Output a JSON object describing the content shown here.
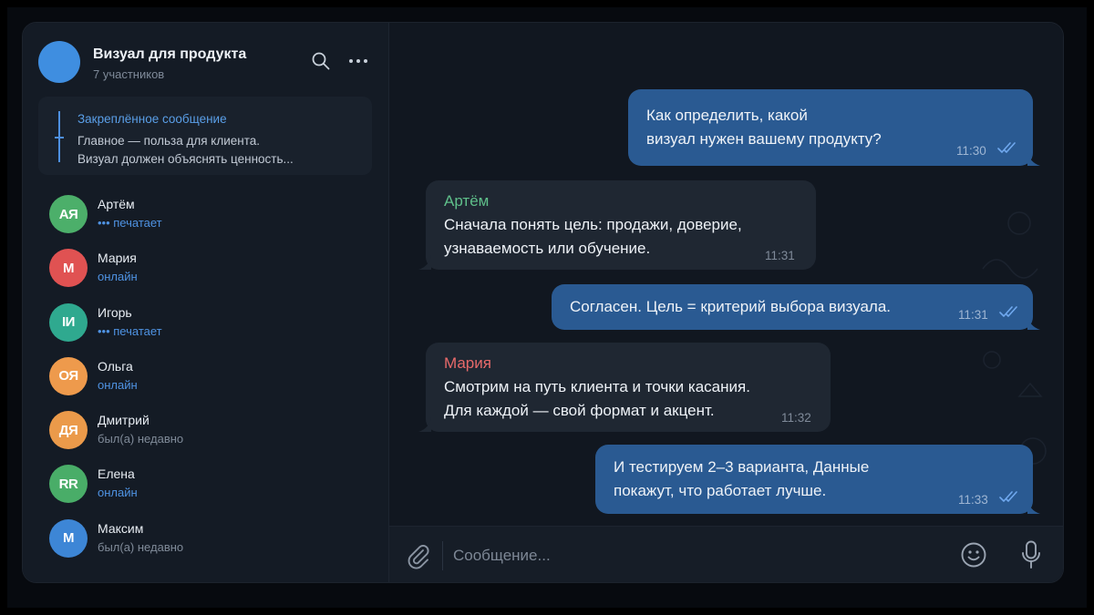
{
  "chat": {
    "title": "Визуал для продукта",
    "subtitle": "7 участников",
    "avatar_color": "#3f8ee0",
    "search_icon": "search-icon",
    "more_icon": "more-horizontal-icon"
  },
  "pinned": {
    "title": "Закреплённое сообщение",
    "line1": "Главное — польза для клиента.",
    "line2": "Визуал должен объяснять ценность..."
  },
  "members": [
    {
      "name": "Артём",
      "initials": "АЯ",
      "status": "••• печатает",
      "state": "typing",
      "color": "#4caf6a"
    },
    {
      "name": "Мария",
      "initials": "М",
      "status": "онлайн",
      "state": "online",
      "color": "#e05252"
    },
    {
      "name": "Игорь",
      "initials": "ІИ",
      "status": "••• печатает",
      "state": "typing",
      "color": "#2fa98f"
    },
    {
      "name": "Ольга",
      "initials": "ОЯ",
      "status": "онлайн",
      "state": "online",
      "color": "#ee9a4c"
    },
    {
      "name": "Дмитрий",
      "initials": "ДЯ",
      "status": "был(а) недавно",
      "state": "recent",
      "color": "#eb9a4a"
    },
    {
      "name": "Елена",
      "initials": "RR",
      "status": "онлайн",
      "state": "online",
      "color": "#49ad68"
    },
    {
      "name": "Максим",
      "initials": "М",
      "status": "был(а) недавно",
      "state": "recent",
      "color": "#3d86d6"
    }
  ],
  "messages": [
    {
      "direction": "out",
      "lines": [
        "Как определить, какой",
        "визуал нужен вашему продукту?"
      ],
      "time": "11:30",
      "read": true
    },
    {
      "direction": "in",
      "sender": "Артём",
      "sender_color": "#5fbf8a",
      "lines": [
        "Сначала понять цель: продажи, доверие,",
        "узнаваемость или обучение."
      ],
      "time": "11:31"
    },
    {
      "direction": "out",
      "lines": [
        "Согласен. Цель = критерий выбора визуала."
      ],
      "time": "11:31",
      "read": true
    },
    {
      "direction": "in",
      "sender": "Мария",
      "sender_color": "#e86a6a",
      "lines": [
        "Смотрим на путь клиента и точки касания.",
        "Для каждой — свой формат и акцент."
      ],
      "time": "11:32"
    },
    {
      "direction": "out",
      "lines": [
        "И тестируем 2–3 варианта, Данные",
        "покажут, что работает лучше."
      ],
      "time": "11:33",
      "read": true
    }
  ],
  "composer": {
    "placeholder": "Сообщение...",
    "attach_icon": "paperclip-icon",
    "emoji_icon": "emoji-icon",
    "mic_icon": "microphone-icon"
  },
  "colors": {
    "outgoing_bubble": "#2a5a92",
    "incoming_bubble": "#1f2732",
    "accent": "#4f93e3"
  }
}
